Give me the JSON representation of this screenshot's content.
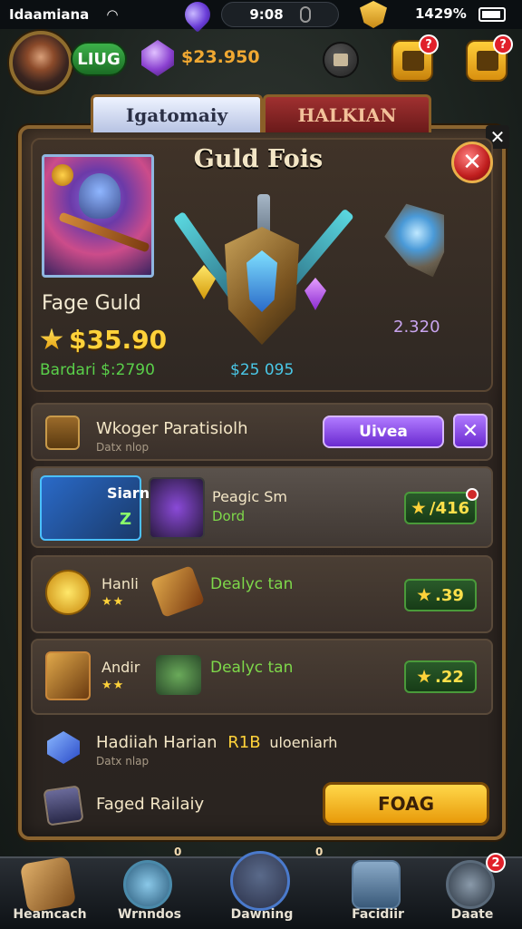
{
  "status_bar": {
    "carrier": "Idaamiana",
    "time": "9:08",
    "battery": "1429%"
  },
  "top_bar": {
    "level": "LIUG",
    "currency": "$23.950",
    "notification_count_1": "?",
    "notification_count_2": "?"
  },
  "tabs": [
    {
      "label": "Igatomaiy",
      "active": true
    },
    {
      "label": "HALKIAN",
      "active": false
    }
  ],
  "hero": {
    "panel_title": "Guld Fois",
    "name": "Fage Guld",
    "price": "$35.90",
    "sub_label": "Bardari $:2790",
    "shield_value": "$25 095",
    "amulet_value": "2.320"
  },
  "rows": [
    {
      "title": "Wkoger Paratisiolh",
      "subtitle": "Datx nlop",
      "action_label": "Uivea"
    },
    {
      "item_a_name": "Siarn",
      "item_a_stat": "Z",
      "title": "Peagic Sm",
      "subtitle": "Dord",
      "price": "/416"
    },
    {
      "name": "Hanli",
      "subtitle": "Dealyc tan",
      "price": ".39"
    },
    {
      "name": "Andir",
      "subtitle": "Dealyc tan",
      "price": ".22"
    },
    {
      "title": "Hadiiah Harian",
      "highlight": "R1B",
      "extra": "uloeniarh",
      "subtitle": "Datx nlap"
    },
    {
      "title": "Faged Railaiy",
      "action_label": "FOAG"
    }
  ],
  "bottom_nav": [
    {
      "label": "Heamcach",
      "icon": "map-scroll-icon"
    },
    {
      "label": "Wrnndos",
      "icon": "magnifier-icon",
      "badge": "0"
    },
    {
      "label": "Dawning",
      "icon": "crystal-icon"
    },
    {
      "label": "Facidiir",
      "icon": "robot-icon",
      "badge": "0"
    },
    {
      "label": "Daate",
      "icon": "dragon-icon",
      "badge": "2"
    }
  ],
  "colors": {
    "panel_border": "#8a6430",
    "gold": "#ffd23a",
    "green": "#7ed84a",
    "purple": "#8a40d0",
    "red": "#c01e1e"
  }
}
